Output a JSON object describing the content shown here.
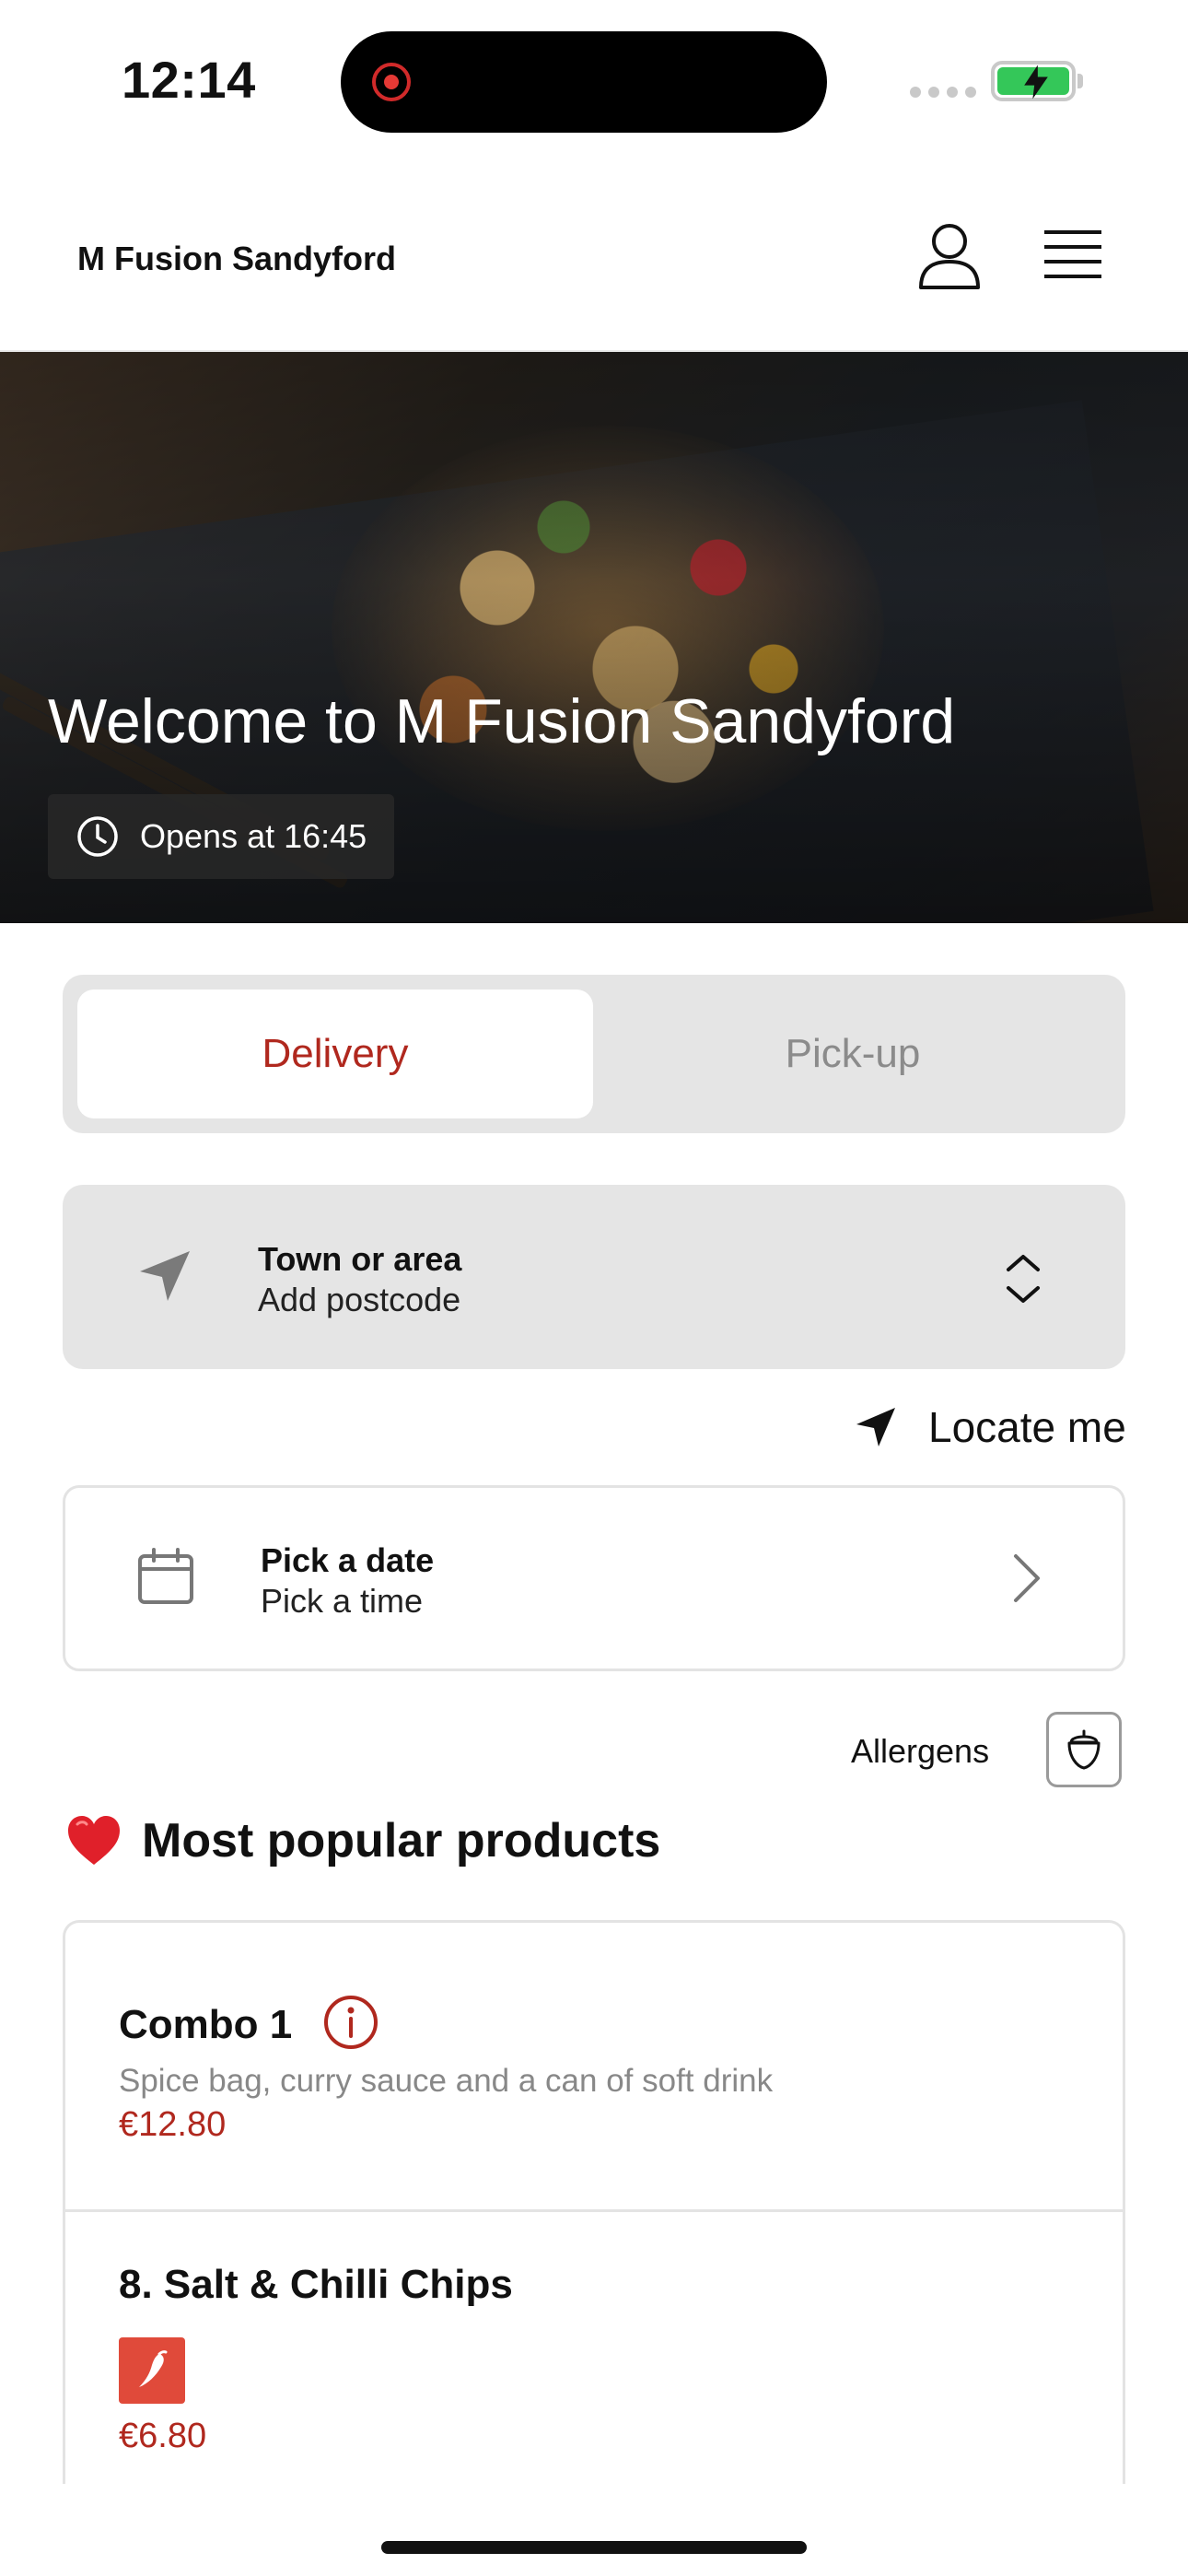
{
  "status_bar": {
    "time": "12:14"
  },
  "header": {
    "store_name": "M Fusion Sandyford",
    "icons": [
      "user-icon",
      "menu-icon"
    ]
  },
  "hero": {
    "title": "Welcome to M Fusion Sandyford",
    "opening_text": "Opens at 16:45"
  },
  "order_mode": {
    "options": [
      "Delivery",
      "Pick-up"
    ],
    "selected": "Delivery"
  },
  "location": {
    "title": "Town or area",
    "subtitle": "Add postcode",
    "locate_label": "Locate me"
  },
  "schedule": {
    "title": "Pick a date",
    "subtitle": "Pick a time"
  },
  "allergens": {
    "label": "Allergens"
  },
  "popular": {
    "heading": "Most popular products",
    "products": [
      {
        "name": "Combo 1",
        "description": "Spice bag, curry sauce and a can of soft drink",
        "price": "€12.80"
      },
      {
        "name": "8. Salt & Chilli Chips",
        "price": "€6.80"
      }
    ]
  },
  "colors": {
    "accent": "#b0281e",
    "battery": "#34c759",
    "chilli_badge": "#e04a3a"
  }
}
